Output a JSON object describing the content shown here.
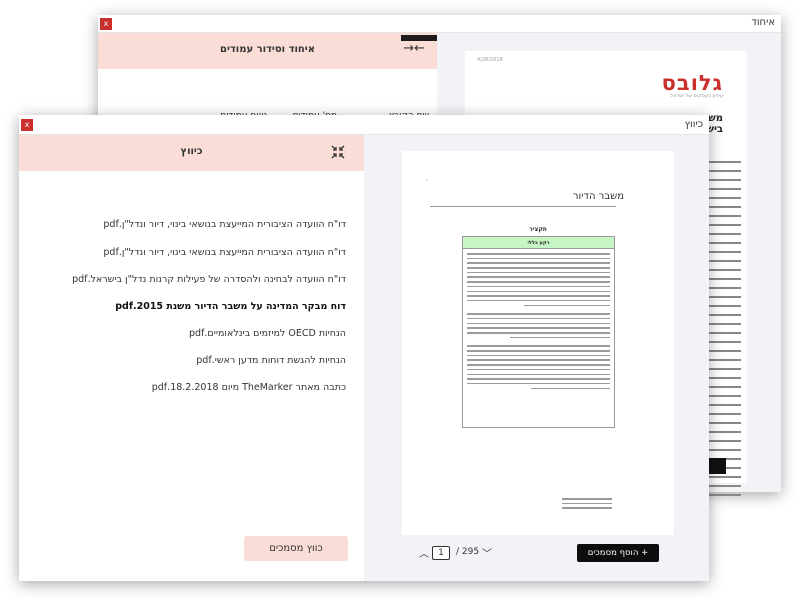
{
  "back_window": {
    "title": "איחוד",
    "close_label": "x",
    "panel_title": "איחוד וסידור עמודים",
    "columns": [
      "שם הקובץ",
      "מס' עמודים",
      "טווח עמודים"
    ],
    "preview": {
      "logo": "גלובס",
      "logo_sub": "עיתון העסקים של ישראל",
      "date": "4/28/2018",
      "heading_line1": "משב",
      "heading_line2": "בישר"
    }
  },
  "front_window": {
    "title": "כיווץ",
    "close_label": "x",
    "panel_title": "כיווץ",
    "files": [
      {
        "name": "דו\"ח הוועדה הציבורית המייעצת בנושאי בינוי, דיור ונדל\"ן.pdf",
        "selected": false
      },
      {
        "name": "דו\"ח הוועדה הציבורית המייעצת בנושאי בינוי, דיור ונדל\"ן.pdf",
        "selected": false
      },
      {
        "name": "דו\"ח הוועדה לבחינה ולהסדרה של פעילות קרנות נדל\"ן בישראל.pdf",
        "selected": false
      },
      {
        "name": "דוח מבקר המדינה על משבר הדיור משנת 2015.pdf",
        "selected": true
      },
      {
        "name": "הנחיות OECD למיזמים בינלאומיים.pdf",
        "selected": false
      },
      {
        "name": "הנחיות להגשת דוחות מדען ראשי.pdf",
        "selected": false
      },
      {
        "name": "כתבה מאתר TheMarker מיום 18.2.2018.pdf",
        "selected": false
      }
    ],
    "compress_button": "כווץ מסמכים",
    "preview": {
      "title": "משבר הדיור",
      "subtitle": "תקציר",
      "box_header": "רקע כללי"
    },
    "pager": {
      "current_page": "1",
      "total": "/ 295"
    },
    "add_button": "+ הוסף מסמכים"
  },
  "colors": {
    "header_pink": "#f9ddd6",
    "close_red": "#c9302c",
    "preview_bg": "#f2f3f6",
    "dark_button": "#0d0d0d",
    "highlight_green": "#c6f5c6"
  }
}
